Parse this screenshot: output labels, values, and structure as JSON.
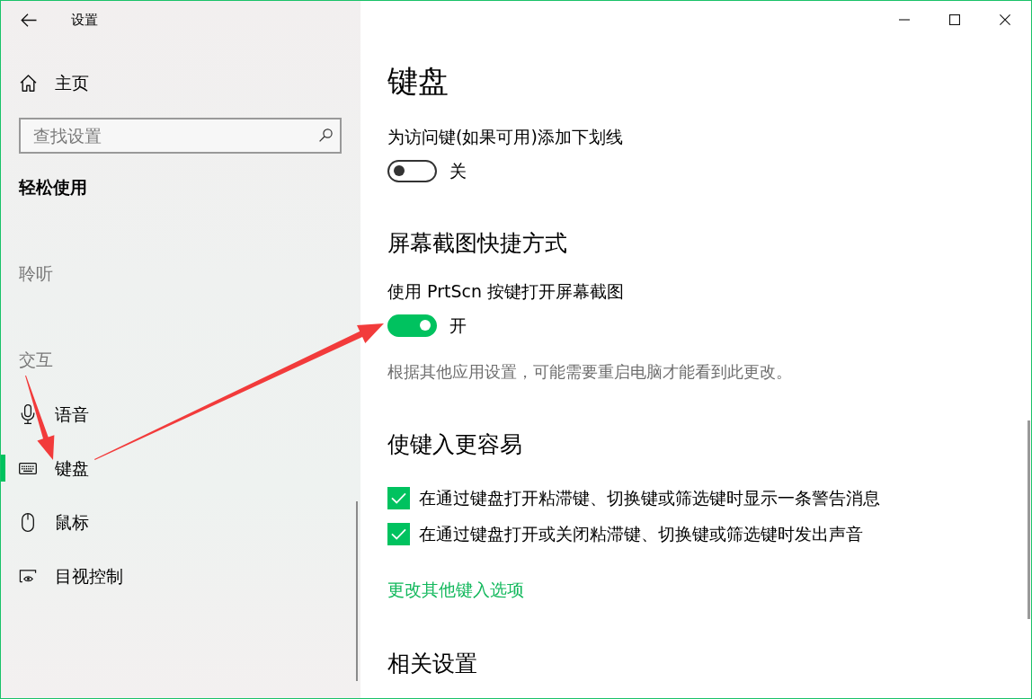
{
  "window": {
    "title": "设置"
  },
  "sidebar": {
    "home": "主页",
    "search": {
      "placeholder": "查找设置"
    },
    "category": "轻松使用",
    "groups": [
      {
        "header": "聆听"
      },
      {
        "header": "交互",
        "items": [
          {
            "label": "语音",
            "selected": false
          },
          {
            "label": "键盘",
            "selected": true
          },
          {
            "label": "鼠标",
            "selected": false
          },
          {
            "label": "目视控制",
            "selected": false
          }
        ]
      }
    ]
  },
  "page": {
    "title": "键盘",
    "sections": [
      {
        "items": [
          {
            "kind": "toggle",
            "label": "为访问键(如果可用)添加下划线",
            "on": false,
            "state_text": "关"
          }
        ]
      },
      {
        "heading": "屏幕截图快捷方式",
        "items": [
          {
            "kind": "toggle",
            "label": "使用 PrtScn 按键打开屏幕截图",
            "on": true,
            "state_text": "开"
          },
          {
            "kind": "note",
            "text": "根据其他应用设置，可能需要重启电脑才能看到此更改。"
          }
        ]
      },
      {
        "heading": "使键入更容易",
        "items": [
          {
            "kind": "checkbox",
            "label": "在通过键盘打开粘滞键、切换键或筛选键时显示一条警告消息",
            "checked": true
          },
          {
            "kind": "checkbox",
            "label": "在通过键盘打开或关闭粘滞键、切换键或筛选键时发出声音",
            "checked": true
          },
          {
            "kind": "link",
            "text": "更改其他键入选项"
          }
        ]
      },
      {
        "heading": "相关设置"
      }
    ]
  }
}
